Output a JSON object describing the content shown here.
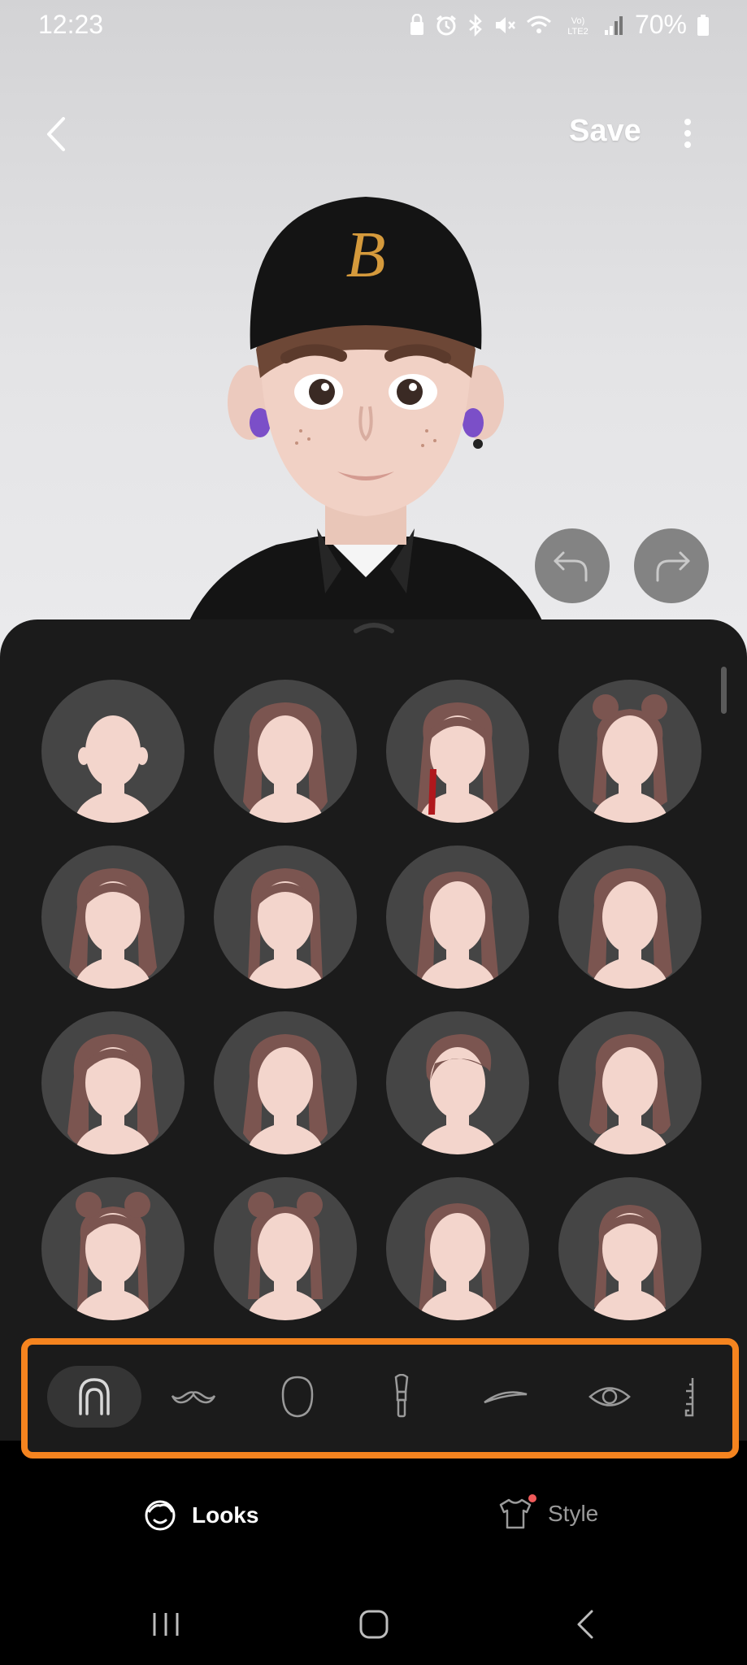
{
  "status_bar": {
    "time": "12:23",
    "battery": "70%",
    "icons": [
      "lock-icon",
      "alarm-icon",
      "bluetooth-icon",
      "mute-icon",
      "wifi-icon",
      "volte-icon",
      "signal-icon",
      "battery-icon"
    ],
    "volte": [
      "Vo)",
      "LTE2"
    ]
  },
  "top_bar": {
    "save_label": "Save"
  },
  "avatar": {
    "cap_letter": "B",
    "cap_color": "#141414",
    "letter_color": "#d59a3c"
  },
  "hair_options": [
    {
      "style": "bald"
    },
    {
      "style": "long-wavy"
    },
    {
      "style": "bangs-red-streak"
    },
    {
      "style": "space-buns"
    },
    {
      "style": "bangs-wavy"
    },
    {
      "style": "bangs-straight"
    },
    {
      "style": "half-up"
    },
    {
      "style": "long-wavy-parted"
    },
    {
      "style": "curly-bangs"
    },
    {
      "style": "headband-wavy"
    },
    {
      "style": "short-crop"
    },
    {
      "style": "medium-wavy"
    },
    {
      "style": "space-buns-straight"
    },
    {
      "style": "messy-buns"
    },
    {
      "style": "long-parted"
    },
    {
      "style": "straight-bangs"
    }
  ],
  "categories": [
    {
      "name": "hair",
      "icon": "hair-icon",
      "active": true
    },
    {
      "name": "facial-hair",
      "icon": "mustache-icon",
      "active": false
    },
    {
      "name": "face-shape",
      "icon": "face-shape-icon",
      "active": false
    },
    {
      "name": "makeup",
      "icon": "makeup-brush-icon",
      "active": false
    },
    {
      "name": "eyebrows",
      "icon": "eyebrow-icon",
      "active": false
    },
    {
      "name": "eyes",
      "icon": "eye-icon",
      "active": false
    },
    {
      "name": "more",
      "icon": "ruler-icon",
      "active": false
    }
  ],
  "tabs": {
    "looks_label": "Looks",
    "style_label": "Style"
  },
  "colors": {
    "accent_highlight": "#f5841f",
    "panel_bg": "#1b1b1b",
    "hair_brown": "#7b5550",
    "skin": "#f3d5cc",
    "new_dot": "#f05a5a"
  }
}
